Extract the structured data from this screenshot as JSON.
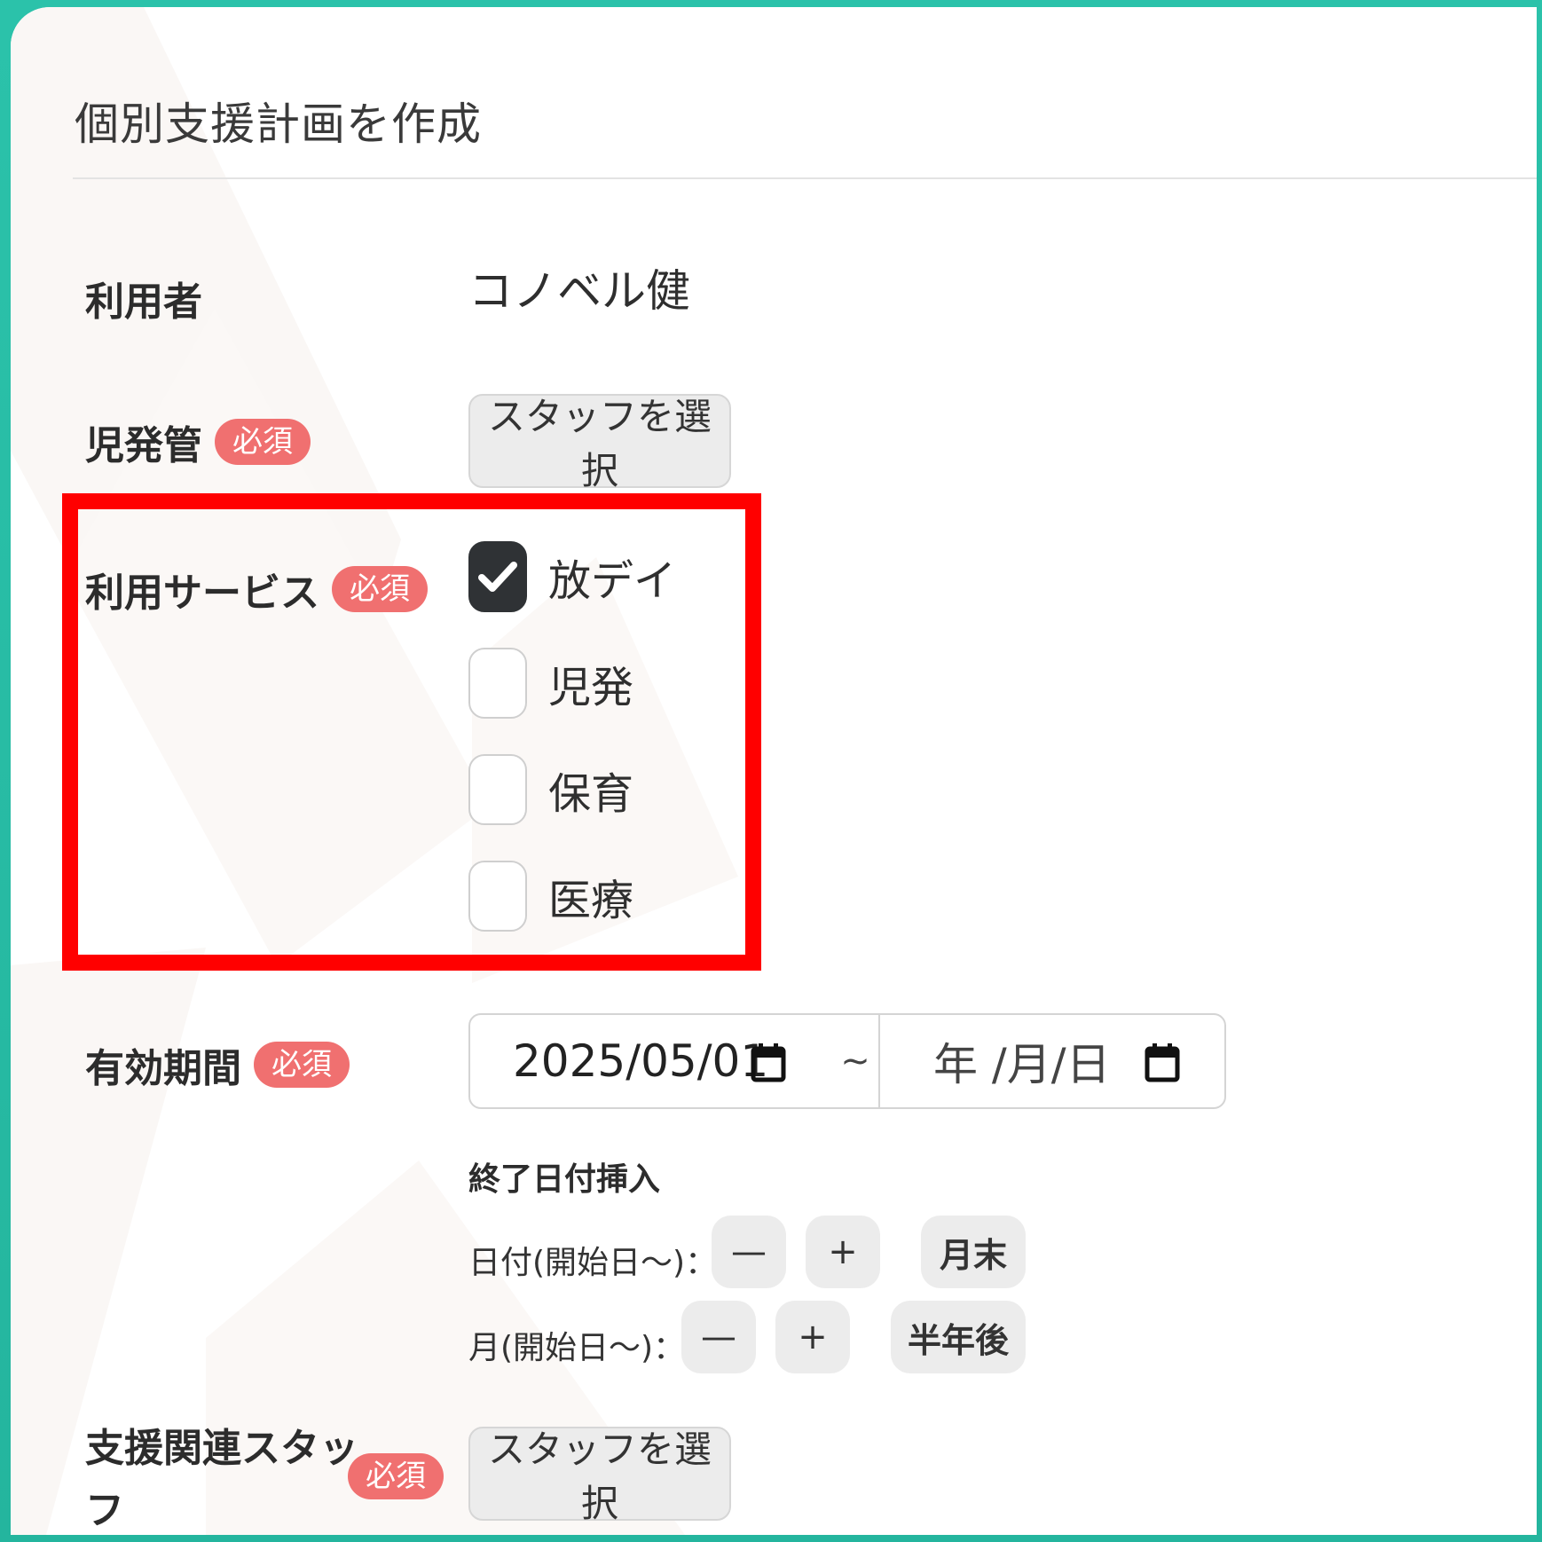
{
  "modal": {
    "title": "個別支援計画を作成"
  },
  "form": {
    "user": {
      "label": "利用者",
      "value": "コノベル健"
    },
    "manager": {
      "label": "児発管",
      "badge": "必須",
      "button": "スタッフを選択"
    },
    "services": {
      "label": "利用サービス",
      "badge": "必須",
      "options": [
        {
          "label": "放デイ",
          "checked": true
        },
        {
          "label": "児発",
          "checked": false
        },
        {
          "label": "保育",
          "checked": false
        },
        {
          "label": "医療",
          "checked": false
        }
      ]
    },
    "period": {
      "label": "有効期間",
      "badge": "必須",
      "start": "2025/05/01",
      "separator": "~",
      "end_placeholder": "年 /月/日",
      "end_insert_heading": "終了日付挿入",
      "day_row_label": "日付(開始日～)：",
      "month_row_label": "月(開始日～)：",
      "minus": "—",
      "plus": "+",
      "month_end": "月末",
      "half_year": "半年後"
    },
    "support_staff": {
      "label_line1": "支援関連スタッ",
      "label_line2": "フ",
      "badge": "必須",
      "button": "スタッフを選択"
    }
  },
  "colors": {
    "frame": "#2abfa8",
    "badge": "#f07070",
    "highlight": "#ff0000",
    "checkbox_checked": "#2f3235"
  },
  "icons": {
    "check": "check-icon",
    "calendar": "calendar-icon"
  }
}
